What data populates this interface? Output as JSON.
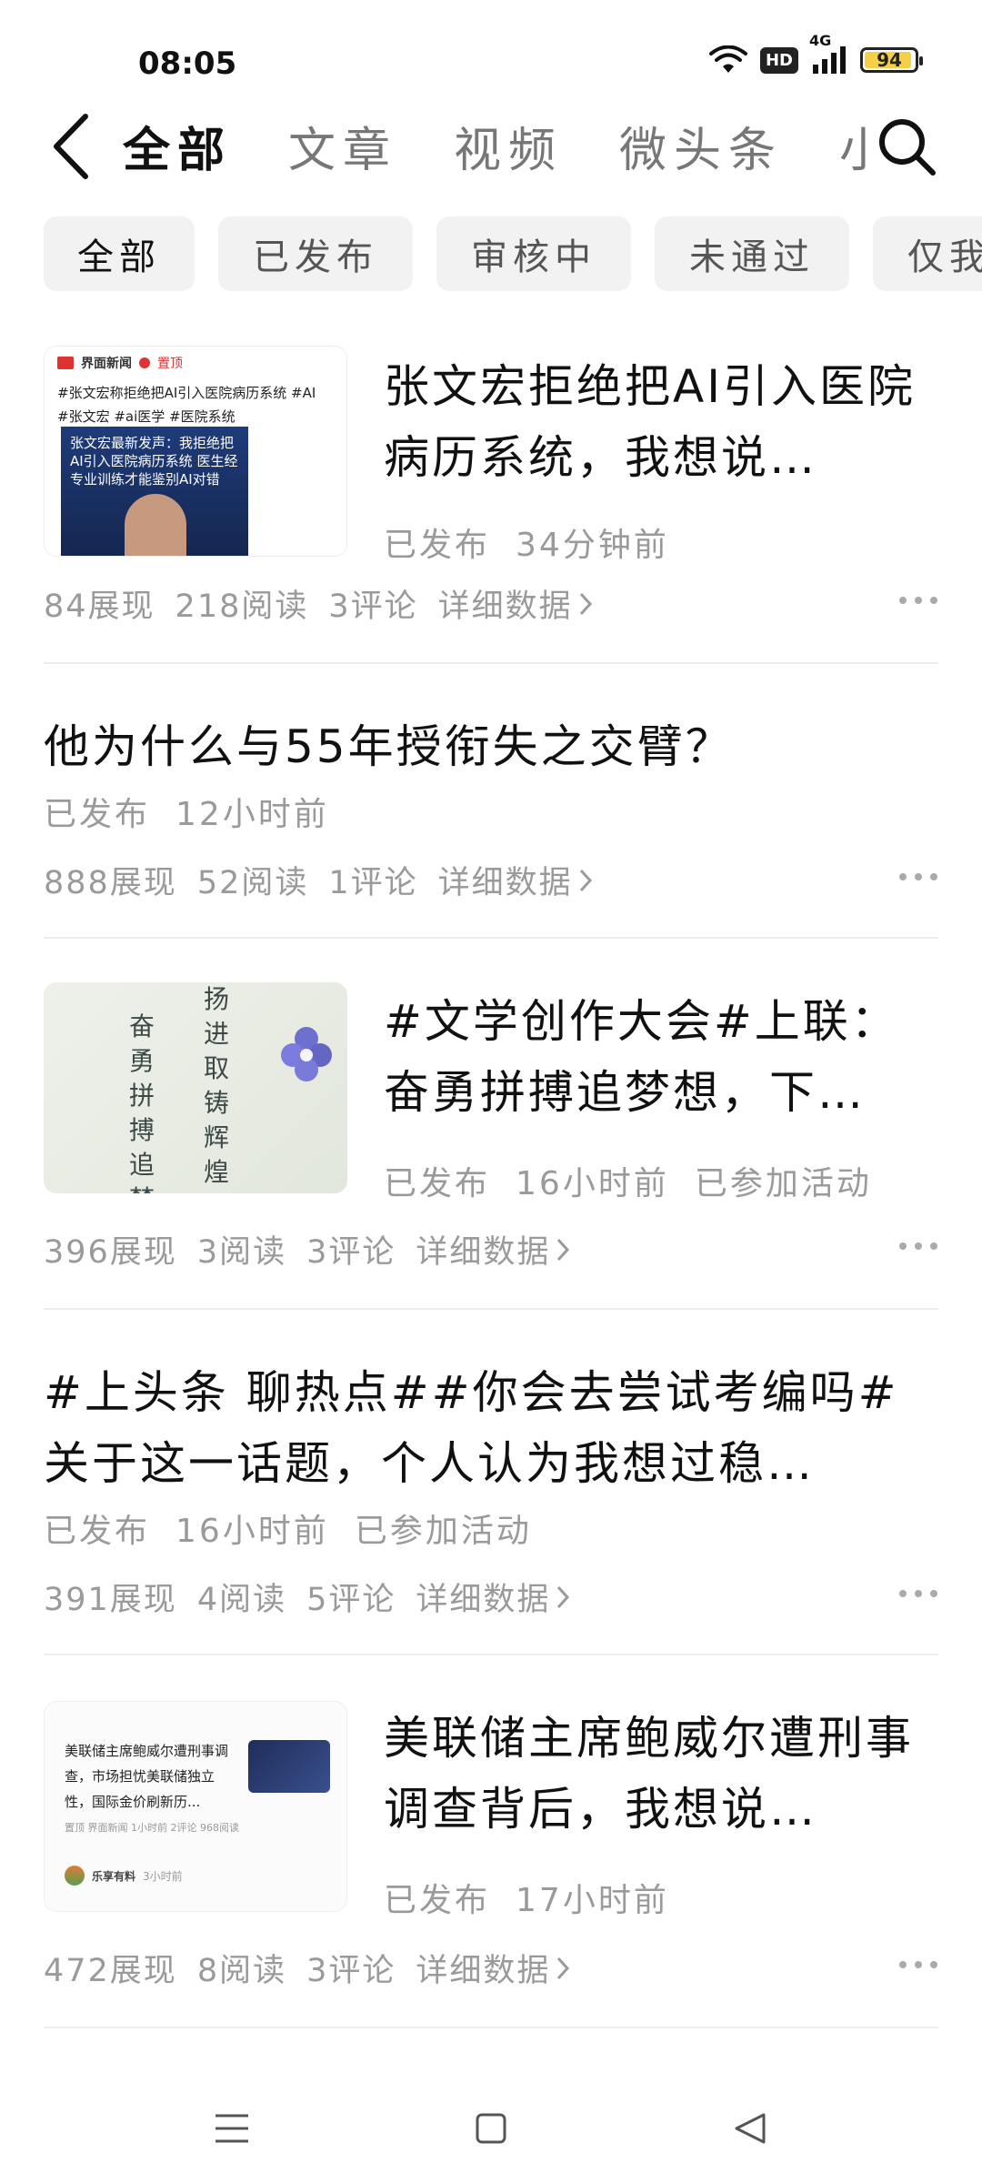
{
  "status_bar": {
    "time": "08:05",
    "hd_label": "HD",
    "network_label": "4G",
    "battery": "94",
    "battery_level": 0.94
  },
  "tabs": [
    "全部",
    "文章",
    "视频",
    "微头条",
    "小视频"
  ],
  "filters": [
    "全部",
    "已发布",
    "审核中",
    "未通过",
    "仅我可见"
  ],
  "thumb1": {
    "source": "界面新闻",
    "top_label": "置顶",
    "tags": "#张文宏称拒绝把AI引入医院病历系统 #AI #张文宏 #ai医学 #医院系统",
    "caption": "张文宏最新发声：我拒绝把AI引入医院病历系统 医生经专业训练才能鉴别AI对错"
  },
  "thumb2": {
    "col1": "奋勇拼搏追梦想",
    "col2": "扬进取铸辉煌"
  },
  "thumb3": {
    "text": "美联储主席鲍威尔遭刑事调查，市场担忧美联储独立性，国际金价刷新历...",
    "meta": "置顶 界面新闻 1小时前 2评论 968阅读",
    "sub_author": "乐享有料",
    "sub_time": "3小时前"
  },
  "posts": [
    {
      "title": "张文宏拒绝把AI引入医院病历系统，我想说…",
      "meta": [
        "已发布",
        "34分钟前"
      ],
      "stats": [
        "84展现",
        "218阅读",
        "3评论",
        "详细数据"
      ]
    },
    {
      "title": "他为什么与55年授衔失之交臂？",
      "meta": [
        "已发布",
        "12小时前"
      ],
      "stats": [
        "888展现",
        "52阅读",
        "1评论",
        "详细数据"
      ]
    },
    {
      "title": "#文学创作大会#上联：奋勇拼搏追梦想，下…",
      "meta": [
        "已发布",
        "16小时前",
        "已参加活动"
      ],
      "stats": [
        "396展现",
        "3阅读",
        "3评论",
        "详细数据"
      ]
    },
    {
      "title": "#上头条 聊热点##你会去尝试考编吗#关于这一话题，个人认为我想过稳…",
      "meta": [
        "已发布",
        "16小时前",
        "已参加活动"
      ],
      "stats": [
        "391展现",
        "4阅读",
        "5评论",
        "详细数据"
      ]
    },
    {
      "title": "美联储主席鲍威尔遭刑事调查背后，我想说…",
      "meta": [
        "已发布",
        "17小时前"
      ],
      "stats": [
        "472展现",
        "8阅读",
        "3评论",
        "详细数据"
      ]
    }
  ],
  "icons": {
    "back": "chevron-left-icon",
    "search": "search-icon",
    "more": "more-horizontal-icon",
    "detail": "chevron-right-icon"
  }
}
